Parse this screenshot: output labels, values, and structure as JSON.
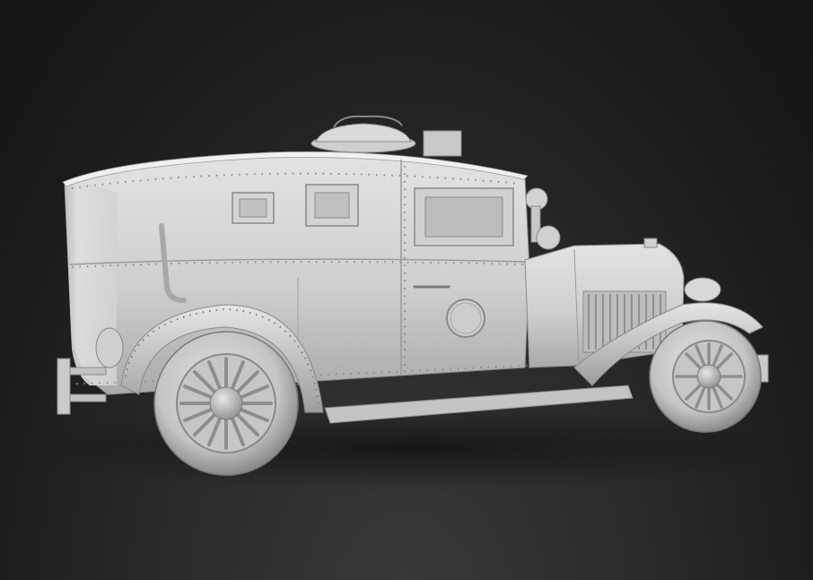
{
  "scene": {
    "subject": "armored-car-3d-render",
    "colors": {
      "background_dark": "#141415",
      "background_mid": "#2b2b2d",
      "clay": "#d6d6d6",
      "clay_shadow": "#9a9a9a",
      "clay_dark": "#6e6e6e",
      "tire": "#cfcfcf"
    }
  }
}
